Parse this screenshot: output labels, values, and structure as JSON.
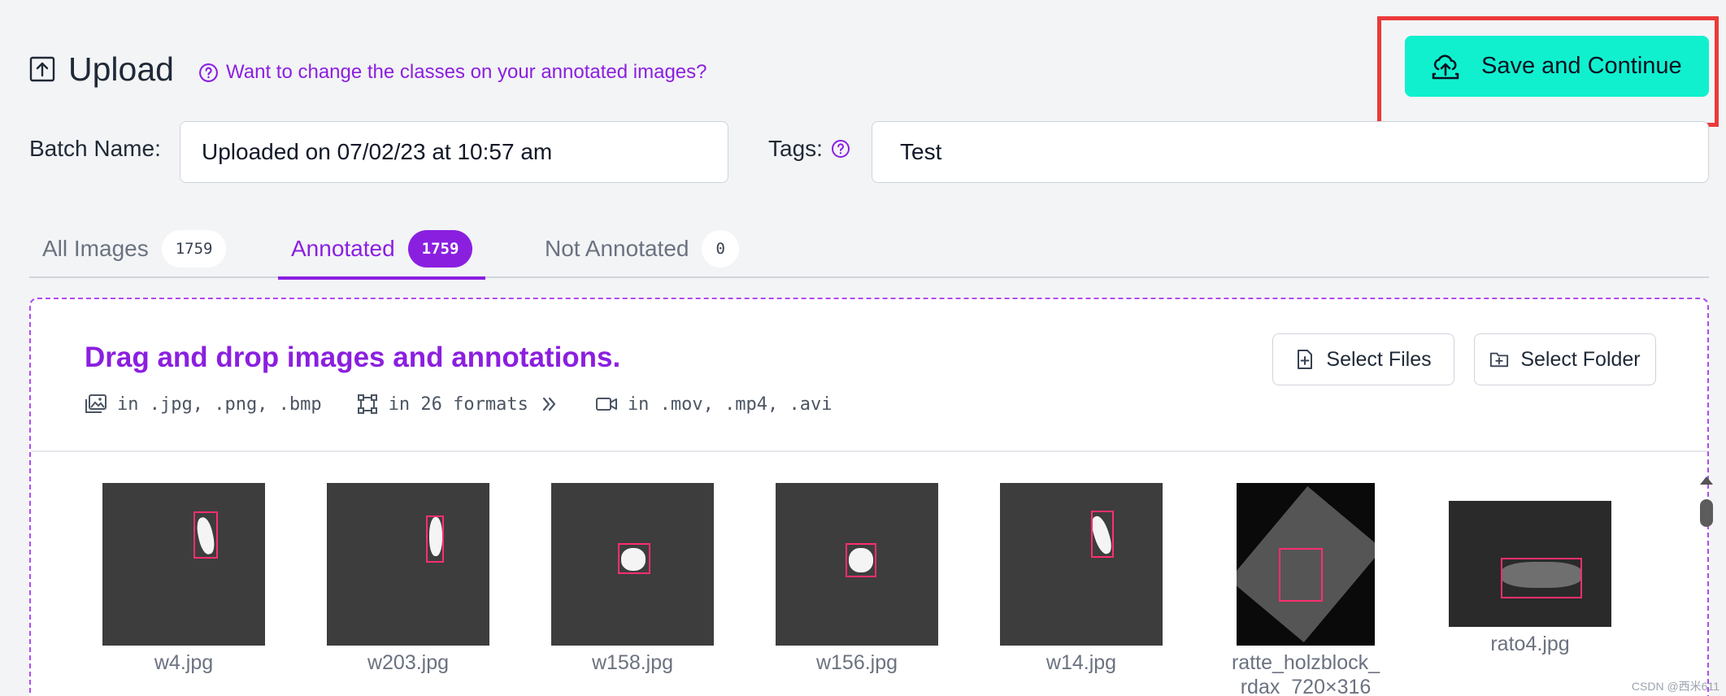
{
  "header": {
    "title": "Upload",
    "help_link": "Want to change the classes on your annotated images?",
    "save_label": "Save and Continue"
  },
  "batch": {
    "label": "Batch Name:",
    "value": "Uploaded on 07/02/23 at 10:57 am"
  },
  "tags": {
    "label": "Tags:",
    "value": "Test"
  },
  "tabs": [
    {
      "label": "All Images",
      "count": "1759",
      "active": false
    },
    {
      "label": "Annotated",
      "count": "1759",
      "active": true
    },
    {
      "label": "Not Annotated",
      "count": "0",
      "active": false
    }
  ],
  "dropzone": {
    "title": "Drag and drop images and annotations.",
    "images_formats": "in .jpg, .png, .bmp",
    "annotation_formats": "in 26 formats",
    "video_formats": "in .mov, .mp4, .avi",
    "select_files": "Select Files",
    "select_folder": "Select Folder"
  },
  "thumbnails": [
    {
      "name": "w4.jpg"
    },
    {
      "name": "w203.jpg"
    },
    {
      "name": "w158.jpg"
    },
    {
      "name": "w156.jpg"
    },
    {
      "name": "w14.jpg"
    },
    {
      "name": "ratte_holzblock_rdax_720×316"
    },
    {
      "name": "rato4.jpg"
    }
  ],
  "watermark": "CSDN @西米611",
  "colors": {
    "accent": "#8b1fe0",
    "save_button": "#10f0cf",
    "highlight": "#ec3a3a",
    "bbox": "#ff2e6e"
  }
}
